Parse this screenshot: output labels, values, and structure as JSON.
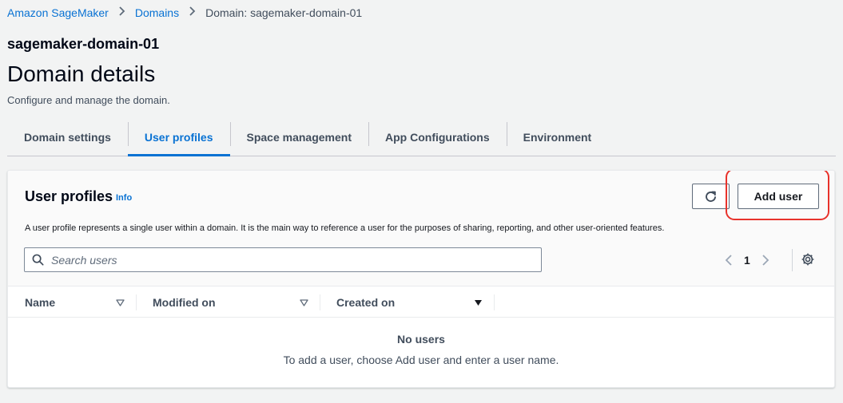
{
  "breadcrumb": {
    "items": [
      "Amazon SageMaker",
      "Domains"
    ],
    "current": "Domain: sagemaker-domain-01"
  },
  "domain_name": "sagemaker-domain-01",
  "page": {
    "title": "Domain details",
    "description": "Configure and manage the domain."
  },
  "tabs": [
    {
      "label": "Domain settings",
      "active": false
    },
    {
      "label": "User profiles",
      "active": true
    },
    {
      "label": "Space management",
      "active": false
    },
    {
      "label": "App Configurations",
      "active": false
    },
    {
      "label": "Environment",
      "active": false
    }
  ],
  "user_profiles": {
    "title": "User profiles",
    "info_label": "Info",
    "add_user_label": "Add user",
    "description": "A user profile represents a single user within a domain. It is the main way to reference a user for the purposes of sharing, reporting, and other user-oriented features.",
    "search": {
      "placeholder": "Search users",
      "value": ""
    },
    "pagination": {
      "current_page": "1"
    },
    "columns": [
      "Name",
      "Modified on",
      "Created on"
    ],
    "empty": {
      "title": "No users",
      "description": "To add a user, choose Add user and enter a user name."
    }
  },
  "colors": {
    "link": "#0972d3",
    "highlight": "#e8322b",
    "background": "#f2f3f3"
  },
  "icons": [
    "chevron-right-icon",
    "refresh-icon",
    "search-icon",
    "chevron-left-icon",
    "settings-gear-icon",
    "sort-caret-icon"
  ]
}
